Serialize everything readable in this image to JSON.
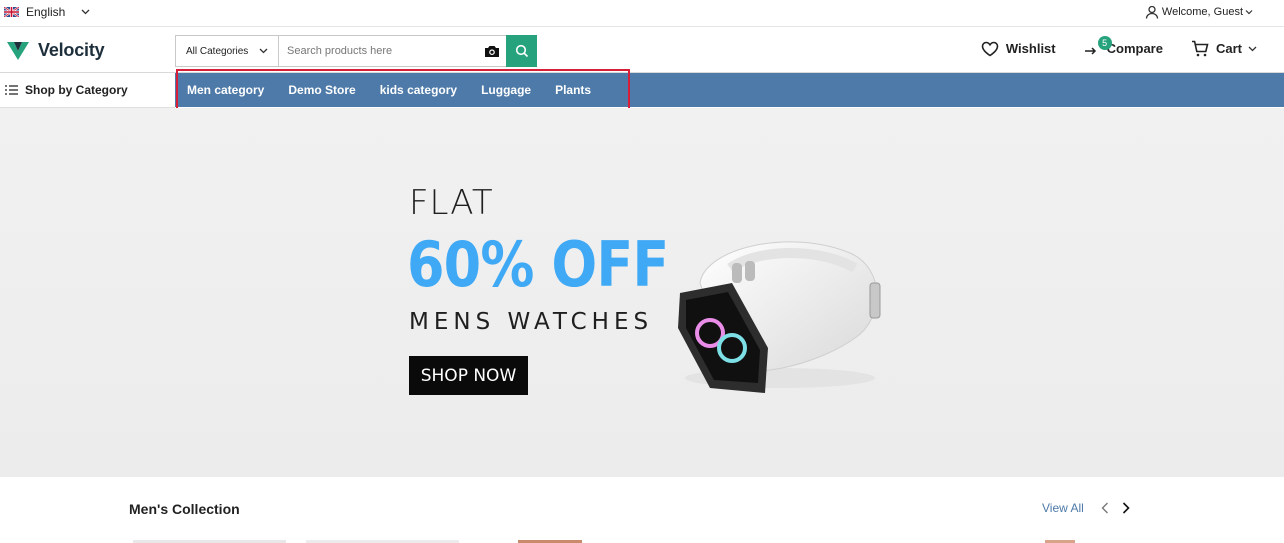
{
  "topbar": {
    "language": "English",
    "welcome": "Welcome, Guest"
  },
  "header": {
    "logo_text": "Velocity",
    "search": {
      "category": "All Categories",
      "placeholder": "Search products here"
    },
    "actions": {
      "wishlist": "Wishlist",
      "compare": "Compare",
      "compare_count": "5",
      "cart": "Cart"
    }
  },
  "nav": {
    "shop_by_category": "Shop by Category",
    "items": [
      "Men category",
      "Demo Store",
      "kids category",
      "Luggage",
      "Plants"
    ]
  },
  "banner": {
    "line1": "FLAT",
    "line2": "60% OFF",
    "line3": "MENS WATCHES",
    "cta": "SHOP NOW"
  },
  "section": {
    "title": "Men's Collection",
    "view_all": "View All"
  },
  "colors": {
    "accent": "#26a37c",
    "nav_bg": "#4d7aa8",
    "highlight": "#d81f3a",
    "banner_blue": "#3fa9f5"
  }
}
